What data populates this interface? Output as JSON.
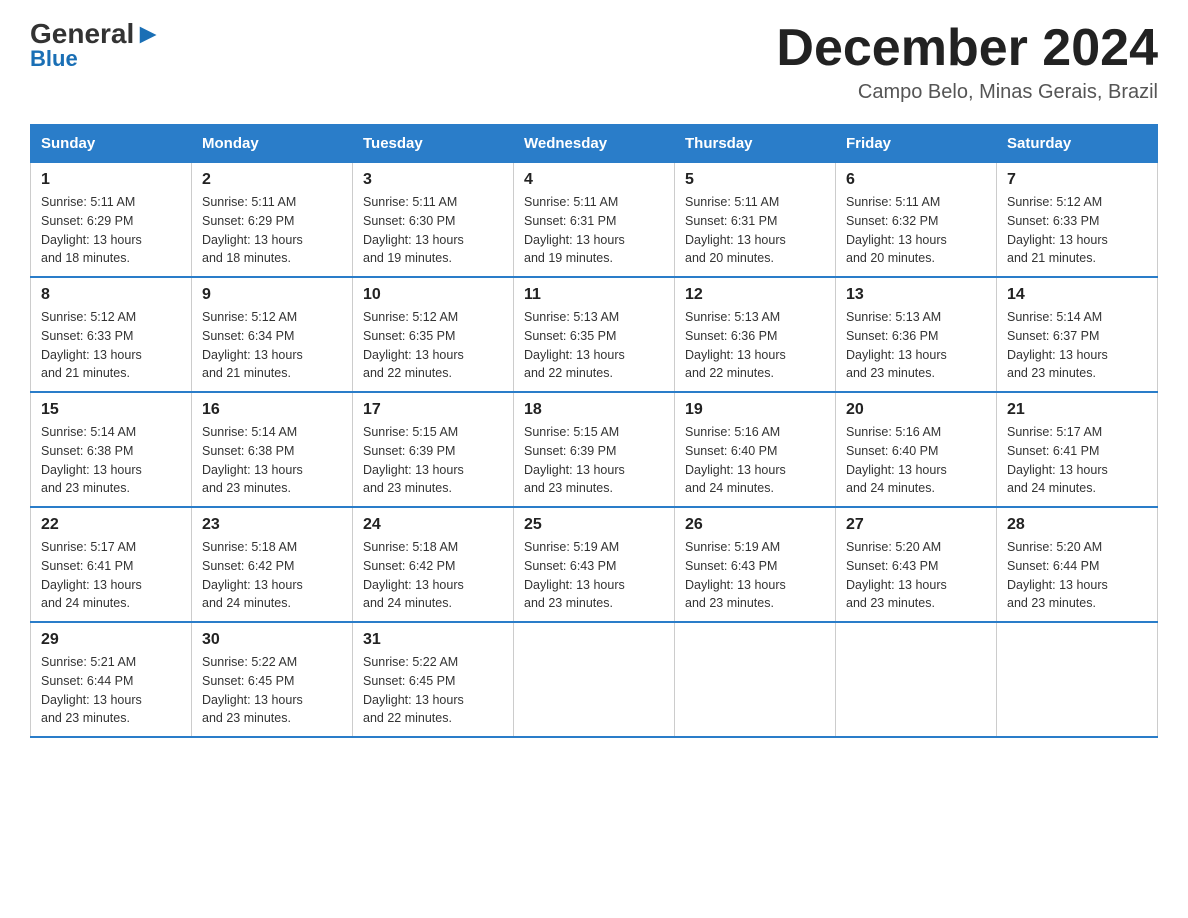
{
  "logo": {
    "general": "General",
    "blue": "Blue",
    "arrow": "▶"
  },
  "title": "December 2024",
  "subtitle": "Campo Belo, Minas Gerais, Brazil",
  "days_of_week": [
    "Sunday",
    "Monday",
    "Tuesday",
    "Wednesday",
    "Thursday",
    "Friday",
    "Saturday"
  ],
  "weeks": [
    [
      {
        "day": "1",
        "sunrise": "5:11 AM",
        "sunset": "6:29 PM",
        "daylight": "13 hours and 18 minutes."
      },
      {
        "day": "2",
        "sunrise": "5:11 AM",
        "sunset": "6:29 PM",
        "daylight": "13 hours and 18 minutes."
      },
      {
        "day": "3",
        "sunrise": "5:11 AM",
        "sunset": "6:30 PM",
        "daylight": "13 hours and 19 minutes."
      },
      {
        "day": "4",
        "sunrise": "5:11 AM",
        "sunset": "6:31 PM",
        "daylight": "13 hours and 19 minutes."
      },
      {
        "day": "5",
        "sunrise": "5:11 AM",
        "sunset": "6:31 PM",
        "daylight": "13 hours and 20 minutes."
      },
      {
        "day": "6",
        "sunrise": "5:11 AM",
        "sunset": "6:32 PM",
        "daylight": "13 hours and 20 minutes."
      },
      {
        "day": "7",
        "sunrise": "5:12 AM",
        "sunset": "6:33 PM",
        "daylight": "13 hours and 21 minutes."
      }
    ],
    [
      {
        "day": "8",
        "sunrise": "5:12 AM",
        "sunset": "6:33 PM",
        "daylight": "13 hours and 21 minutes."
      },
      {
        "day": "9",
        "sunrise": "5:12 AM",
        "sunset": "6:34 PM",
        "daylight": "13 hours and 21 minutes."
      },
      {
        "day": "10",
        "sunrise": "5:12 AM",
        "sunset": "6:35 PM",
        "daylight": "13 hours and 22 minutes."
      },
      {
        "day": "11",
        "sunrise": "5:13 AM",
        "sunset": "6:35 PM",
        "daylight": "13 hours and 22 minutes."
      },
      {
        "day": "12",
        "sunrise": "5:13 AM",
        "sunset": "6:36 PM",
        "daylight": "13 hours and 22 minutes."
      },
      {
        "day": "13",
        "sunrise": "5:13 AM",
        "sunset": "6:36 PM",
        "daylight": "13 hours and 23 minutes."
      },
      {
        "day": "14",
        "sunrise": "5:14 AM",
        "sunset": "6:37 PM",
        "daylight": "13 hours and 23 minutes."
      }
    ],
    [
      {
        "day": "15",
        "sunrise": "5:14 AM",
        "sunset": "6:38 PM",
        "daylight": "13 hours and 23 minutes."
      },
      {
        "day": "16",
        "sunrise": "5:14 AM",
        "sunset": "6:38 PM",
        "daylight": "13 hours and 23 minutes."
      },
      {
        "day": "17",
        "sunrise": "5:15 AM",
        "sunset": "6:39 PM",
        "daylight": "13 hours and 23 minutes."
      },
      {
        "day": "18",
        "sunrise": "5:15 AM",
        "sunset": "6:39 PM",
        "daylight": "13 hours and 23 minutes."
      },
      {
        "day": "19",
        "sunrise": "5:16 AM",
        "sunset": "6:40 PM",
        "daylight": "13 hours and 24 minutes."
      },
      {
        "day": "20",
        "sunrise": "5:16 AM",
        "sunset": "6:40 PM",
        "daylight": "13 hours and 24 minutes."
      },
      {
        "day": "21",
        "sunrise": "5:17 AM",
        "sunset": "6:41 PM",
        "daylight": "13 hours and 24 minutes."
      }
    ],
    [
      {
        "day": "22",
        "sunrise": "5:17 AM",
        "sunset": "6:41 PM",
        "daylight": "13 hours and 24 minutes."
      },
      {
        "day": "23",
        "sunrise": "5:18 AM",
        "sunset": "6:42 PM",
        "daylight": "13 hours and 24 minutes."
      },
      {
        "day": "24",
        "sunrise": "5:18 AM",
        "sunset": "6:42 PM",
        "daylight": "13 hours and 24 minutes."
      },
      {
        "day": "25",
        "sunrise": "5:19 AM",
        "sunset": "6:43 PM",
        "daylight": "13 hours and 23 minutes."
      },
      {
        "day": "26",
        "sunrise": "5:19 AM",
        "sunset": "6:43 PM",
        "daylight": "13 hours and 23 minutes."
      },
      {
        "day": "27",
        "sunrise": "5:20 AM",
        "sunset": "6:43 PM",
        "daylight": "13 hours and 23 minutes."
      },
      {
        "day": "28",
        "sunrise": "5:20 AM",
        "sunset": "6:44 PM",
        "daylight": "13 hours and 23 minutes."
      }
    ],
    [
      {
        "day": "29",
        "sunrise": "5:21 AM",
        "sunset": "6:44 PM",
        "daylight": "13 hours and 23 minutes."
      },
      {
        "day": "30",
        "sunrise": "5:22 AM",
        "sunset": "6:45 PM",
        "daylight": "13 hours and 23 minutes."
      },
      {
        "day": "31",
        "sunrise": "5:22 AM",
        "sunset": "6:45 PM",
        "daylight": "13 hours and 22 minutes."
      },
      null,
      null,
      null,
      null
    ]
  ],
  "labels": {
    "sunrise": "Sunrise:",
    "sunset": "Sunset:",
    "daylight": "Daylight:"
  }
}
